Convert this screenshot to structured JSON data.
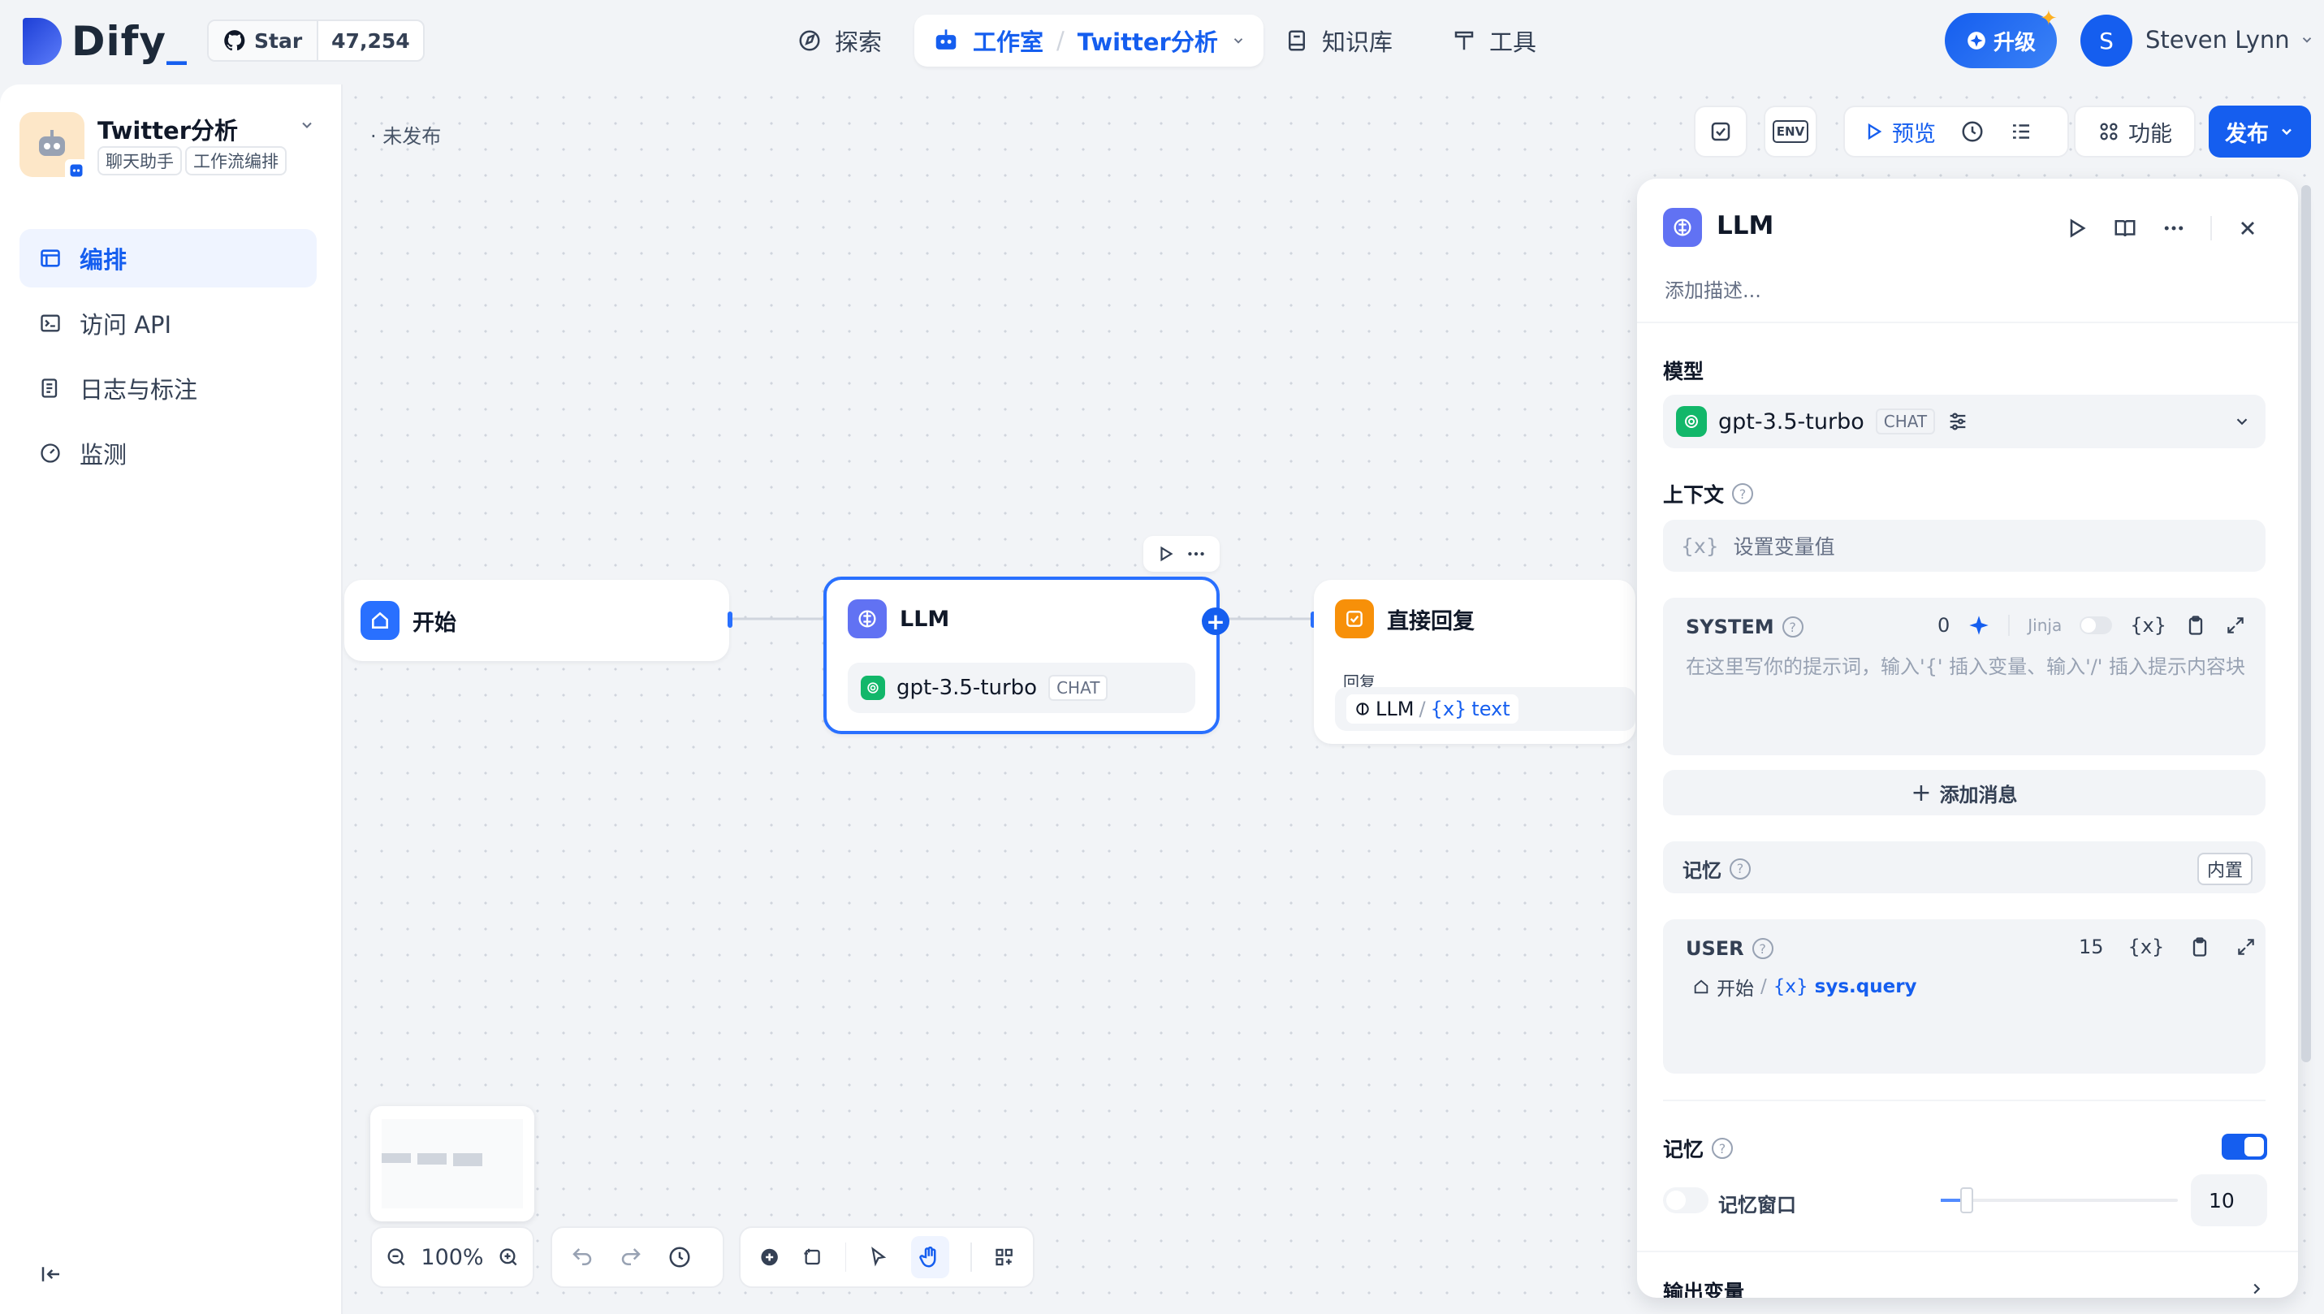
{
  "header": {
    "logo": "Dify",
    "github": {
      "star_label": "Star",
      "count": "47,254"
    },
    "nav": {
      "explore": "探索",
      "studio": "工作室",
      "studio_sep": "/",
      "current_app": "Twitter分析",
      "knowledge": "知识库",
      "tools": "工具"
    },
    "upgrade": "升级",
    "user": {
      "initial": "S",
      "name": "Steven Lynn"
    }
  },
  "sidebar": {
    "app_name": "Twitter分析",
    "tags": [
      "聊天助手",
      "工作流编排"
    ],
    "items": [
      {
        "label": "编排",
        "icon": "layout-icon"
      },
      {
        "label": "访问 API",
        "icon": "terminal-icon"
      },
      {
        "label": "日志与标注",
        "icon": "file-list-icon"
      },
      {
        "label": "监测",
        "icon": "gauge-icon"
      }
    ]
  },
  "canvas": {
    "status": "· 未发布",
    "toolbar": {
      "preview": "预览",
      "features": "功能",
      "publish": "发布",
      "env": "ENV"
    },
    "nodes": {
      "start": {
        "title": "开始"
      },
      "llm": {
        "title": "LLM",
        "model": "gpt-3.5-turbo",
        "mode": "CHAT"
      },
      "answer": {
        "title": "直接回复",
        "reply_label": "回复",
        "var_node": "LLM",
        "var_sep": "/",
        "var_name": "text"
      }
    },
    "zoom": "100%"
  },
  "panel": {
    "title": "LLM",
    "description_placeholder": "添加描述...",
    "model_label": "模型",
    "model": "gpt-3.5-turbo",
    "model_mode": "CHAT",
    "context_label": "上下文",
    "context_placeholder": "设置变量值",
    "system": {
      "label": "SYSTEM",
      "count": "0",
      "jinja": "Jinja",
      "placeholder": "在这里写你的提示词，输入'{' 插入变量、输入'/' 插入提示内容块"
    },
    "add_message": "添加消息",
    "memory_builtin_label": "记忆",
    "builtin_badge": "内置",
    "user": {
      "label": "USER",
      "count": "15",
      "var_node": "开始",
      "var_sep": "/",
      "var_name": "sys.query"
    },
    "memory_label": "记忆",
    "memory_window_label": "记忆窗口",
    "memory_window_value": "10",
    "output_label": "输出变量"
  },
  "colors": {
    "primary": "#155eef",
    "llm_icon": "#6172f3",
    "answer_icon": "#f79009",
    "start_icon": "#2970ff"
  }
}
